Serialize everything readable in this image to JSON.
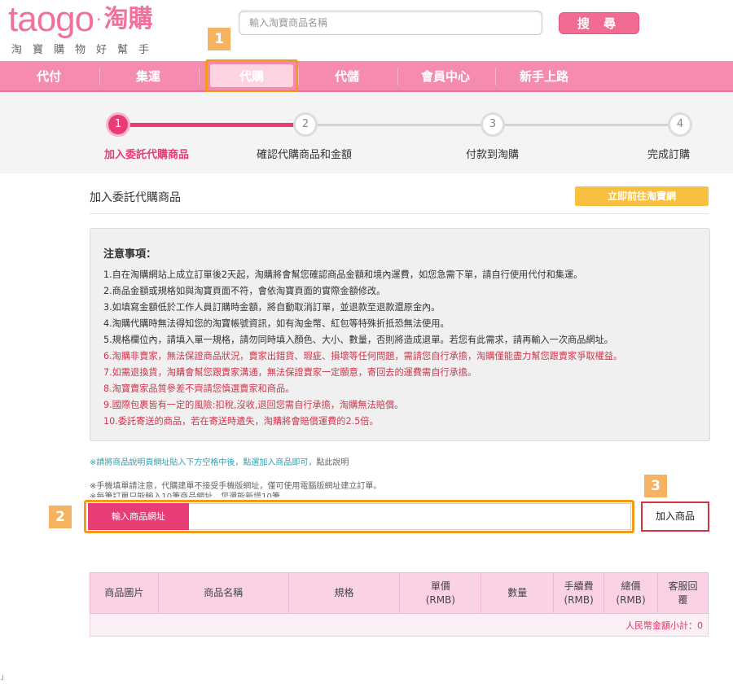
{
  "header": {
    "logo_en": "taogo",
    "logo_dot": "·",
    "logo_zh": "淘購",
    "slogan": "淘寶購物好幫手",
    "search_placeholder": "輸入淘寶商品名稱",
    "search_button": "搜 尋"
  },
  "nav": {
    "items": [
      "代付",
      "集運",
      "代購",
      "代儲",
      "會員中心",
      "新手上路"
    ],
    "active": "代購"
  },
  "badges": [
    "1",
    "2",
    "3"
  ],
  "stepper": {
    "steps": [
      {
        "num": "1",
        "label": "加入委託代購商品",
        "active": true
      },
      {
        "num": "2",
        "label": "確認代購商品和金額",
        "active": false
      },
      {
        "num": "3",
        "label": "付款到淘購",
        "active": false
      },
      {
        "num": "4",
        "label": "完成訂購",
        "active": false
      }
    ]
  },
  "section": {
    "title": "加入委託代購商品",
    "go_button": "立即前往淘寶網"
  },
  "notes": {
    "title": "注意事項：",
    "lines": [
      {
        "text": "1.自在淘購網站上成立訂單後2天起，淘購將會幫您確認商品金額和境內運費，如您急需下單，請自行使用代付和集運。",
        "style": "dark"
      },
      {
        "text": "2.商品金額或規格如與淘寶頁面不符，會依淘寶頁面的實際金額修改。",
        "style": "dark"
      },
      {
        "text": "3.如填寫金額低於工作人員訂購時金額，將自動取消訂單，並退款至退款還原金內。",
        "style": "dark"
      },
      {
        "text": "4.淘購代購時無法得知您的淘寶帳號資訊，如有淘金幣、紅包等特殊折抵恐無法使用。",
        "style": "dark"
      },
      {
        "text": "5.規格欄位內，請填入單一規格，請勿同時填入顏色、大小、數量，否則將造成退單。若您有此需求，請再輸入一次商品網址。",
        "style": "dark"
      },
      {
        "text": "6.淘購非賣家，無法保證商品狀況，賣家出錯貨、瑕疵、損壞等任何問題，需請您自行承擔，淘購僅能盡力幫您跟賣家爭取權益。",
        "style": "red"
      },
      {
        "text": "7.如需退換貨，淘購會幫您跟賣家溝通，無法保證賣家一定願意，寄回去的運費需自行承擔。",
        "style": "red"
      },
      {
        "text": "8.淘寶賣家品質參差不齊請您慎選賣家和商品。",
        "style": "red"
      },
      {
        "text": "9.國際包裹皆有一定的風險:扣稅,沒收,退回您需自行承擔，淘購無法賠償。",
        "style": "red"
      },
      {
        "text": "10.委託寄送的商品，若在寄送時遺失，淘購將會賠償運費的2.5倍。",
        "style": "red"
      }
    ]
  },
  "hints": {
    "paste_hint": "※請將商品說明頁網址貼入下方空格中後，點選加入商品即可，",
    "paste_link": "點此說明",
    "mobile_hint": "※手機填單請注意，代購建單不接受手機版網址，僅可使用電腦版網址建立訂單。",
    "limit_hint": "※每筆訂單只能輸入10筆商品網址，您還能新增10筆"
  },
  "url_form": {
    "label": "輸入商品網址",
    "value": "",
    "add_button": "加入商品"
  },
  "table": {
    "headers": [
      [
        "商品圖片"
      ],
      [
        "商品名稱"
      ],
      [
        "規格"
      ],
      [
        "單價",
        "(RMB)"
      ],
      [
        "數量"
      ],
      [
        "手續費",
        "(RMB)"
      ],
      [
        "總價",
        "(RMB)"
      ],
      [
        "客服回",
        "覆"
      ]
    ],
    "subtotal": "人民幣金額小計：0"
  },
  "footer_mark": "˩",
  "colors": {
    "brand_pink": "#f68bb0",
    "accent": "#e83c75",
    "highlight": "#f39a1a",
    "badge": "#f5b261",
    "go_button": "#f7c041"
  }
}
